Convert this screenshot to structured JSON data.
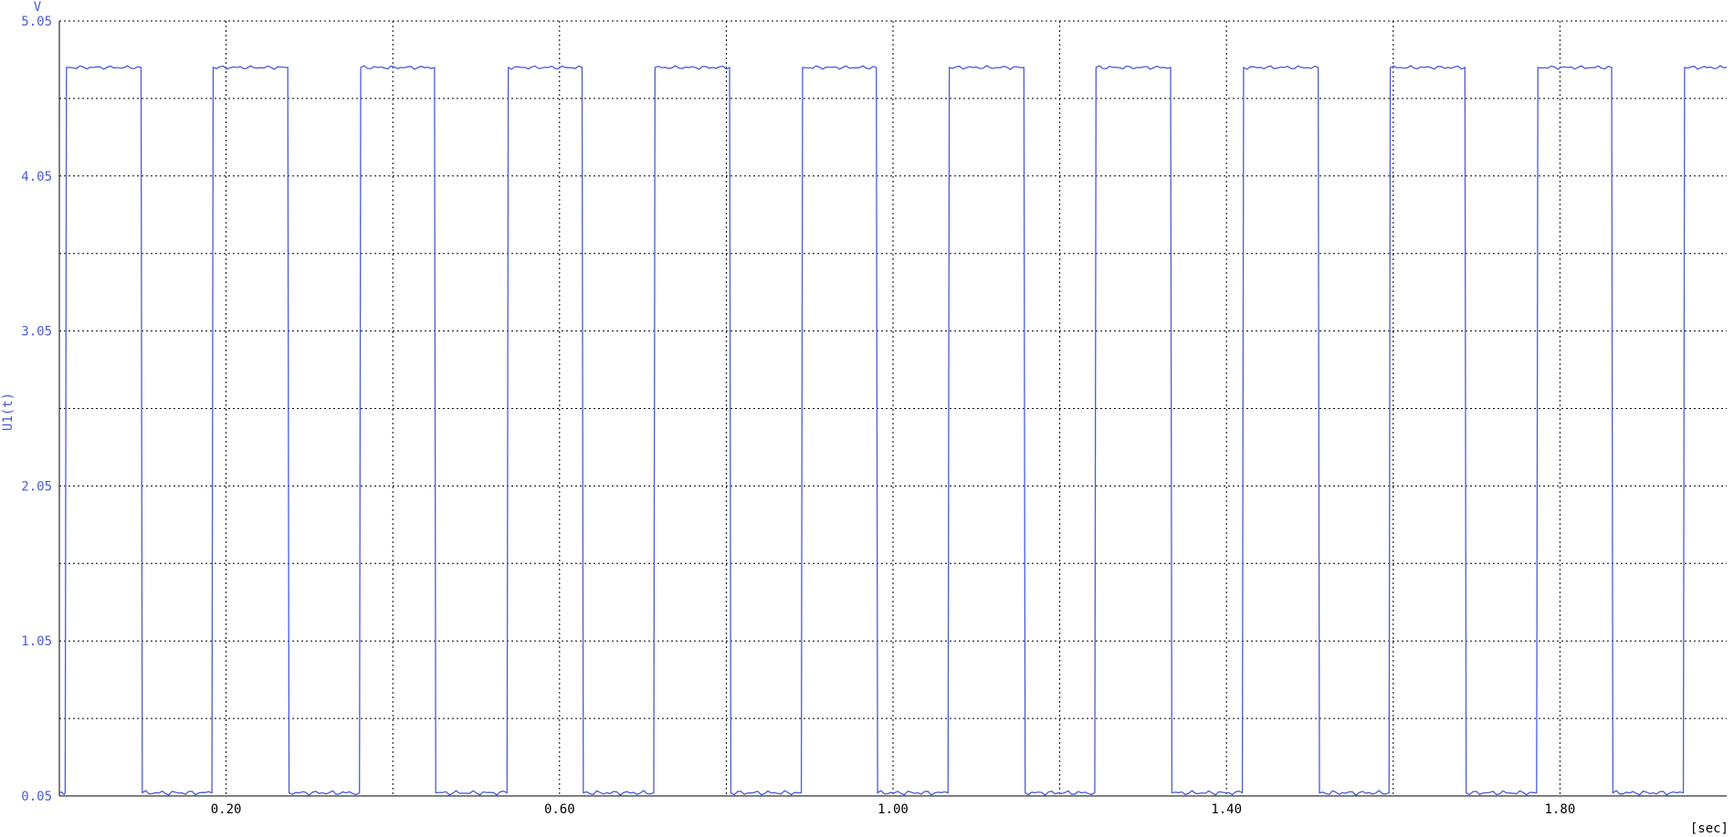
{
  "chart_data": {
    "type": "line",
    "title": "",
    "ylabel": "U1(t)",
    "yunit": "V",
    "xunit": "[sec]",
    "xlim": [
      0.0,
      2.0
    ],
    "ylim": [
      0.05,
      5.05
    ],
    "yticks": [
      0.05,
      1.05,
      2.05,
      3.05,
      4.05,
      5.05
    ],
    "yticks_labels": [
      "0.05",
      "1.05",
      "2.05",
      "3.05",
      "4.05",
      "5.05"
    ],
    "ygrid": [
      0.05,
      0.55,
      1.05,
      1.55,
      2.05,
      2.55,
      3.05,
      3.55,
      4.05,
      4.55,
      5.05
    ],
    "xticks": [
      0.2,
      0.6,
      1.0,
      1.4,
      1.8
    ],
    "xticks_labels": [
      "0.20",
      "0.60",
      "1.00",
      "1.40",
      "1.80"
    ],
    "xgrid": [
      0.2,
      0.4,
      0.6,
      0.8,
      1.0,
      1.2,
      1.4,
      1.6,
      1.8
    ],
    "grid": true,
    "colors": {
      "line": "#4a5bd4",
      "axis_text": "#4a5bd4",
      "grid": "#000000"
    },
    "series": [
      {
        "name": "",
        "high": 4.75,
        "low": 0.07,
        "high_intervals": [
          [
            0.007,
            0.098
          ],
          [
            0.183,
            0.274
          ],
          [
            0.36,
            0.45
          ],
          [
            0.537,
            0.627
          ],
          [
            0.713,
            0.804
          ],
          [
            0.89,
            0.98
          ],
          [
            1.066,
            1.157
          ],
          [
            1.242,
            1.333
          ],
          [
            1.419,
            1.51
          ],
          [
            1.595,
            1.686
          ],
          [
            1.772,
            1.862
          ],
          [
            1.948,
            2.0
          ]
        ]
      }
    ]
  }
}
